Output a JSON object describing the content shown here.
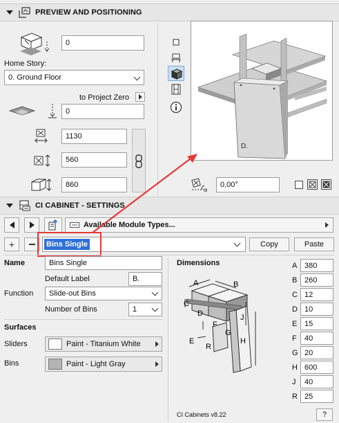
{
  "preview": {
    "title": "PREVIEW AND POSITIONING",
    "elevation_value": "0",
    "home_story_label": "Home Story:",
    "home_story_value": "0. Ground Floor",
    "to_project_zero_label": "to Project Zero",
    "project_zero_value": "0",
    "width_value": "1130",
    "depth_value": "560",
    "height_value": "860",
    "angle_value": "0,00°",
    "preview_label": "D."
  },
  "settings": {
    "title": "CI CABINET - SETTINGS",
    "module_types_label": "Available Module Types...",
    "selected_module": "Bins Single",
    "copy_label": "Copy",
    "paste_label": "Paste",
    "name_label": "Name",
    "name_value": "Bins Single",
    "default_label_label": "Default Label",
    "default_label_value": "B.",
    "function_label": "Function",
    "function_value": "Slide-out Bins",
    "number_of_bins_label": "Number of Bins",
    "number_of_bins_value": "1",
    "surfaces_label": "Surfaces",
    "sliders_label": "Sliders",
    "sliders_value": "Paint - Titanium White",
    "sliders_color": "#ffffff",
    "bins_label": "Bins",
    "bins_value": "Paint - Light Gray",
    "bins_color": "#b4b4b4",
    "dimensions_title": "Dimensions",
    "version": "CI Cabinets v8.22",
    "help_label": "?",
    "dimensions": [
      {
        "key": "A",
        "value": "380"
      },
      {
        "key": "B",
        "value": "260"
      },
      {
        "key": "C",
        "value": "12"
      },
      {
        "key": "D",
        "value": "10"
      },
      {
        "key": "E",
        "value": "15"
      },
      {
        "key": "F",
        "value": "40"
      },
      {
        "key": "G",
        "value": "20"
      },
      {
        "key": "H",
        "value": "600"
      },
      {
        "key": "J",
        "value": "40"
      },
      {
        "key": "R",
        "value": "25"
      }
    ],
    "diagram_letters": {
      "a": "A",
      "b": "B",
      "c": "C",
      "d": "D",
      "e": "E",
      "f": "F",
      "g": "G",
      "h": "H",
      "j": "J",
      "r": "R"
    }
  },
  "colors": {
    "highlight": "#2f6fd8",
    "callout": "#e53935"
  }
}
